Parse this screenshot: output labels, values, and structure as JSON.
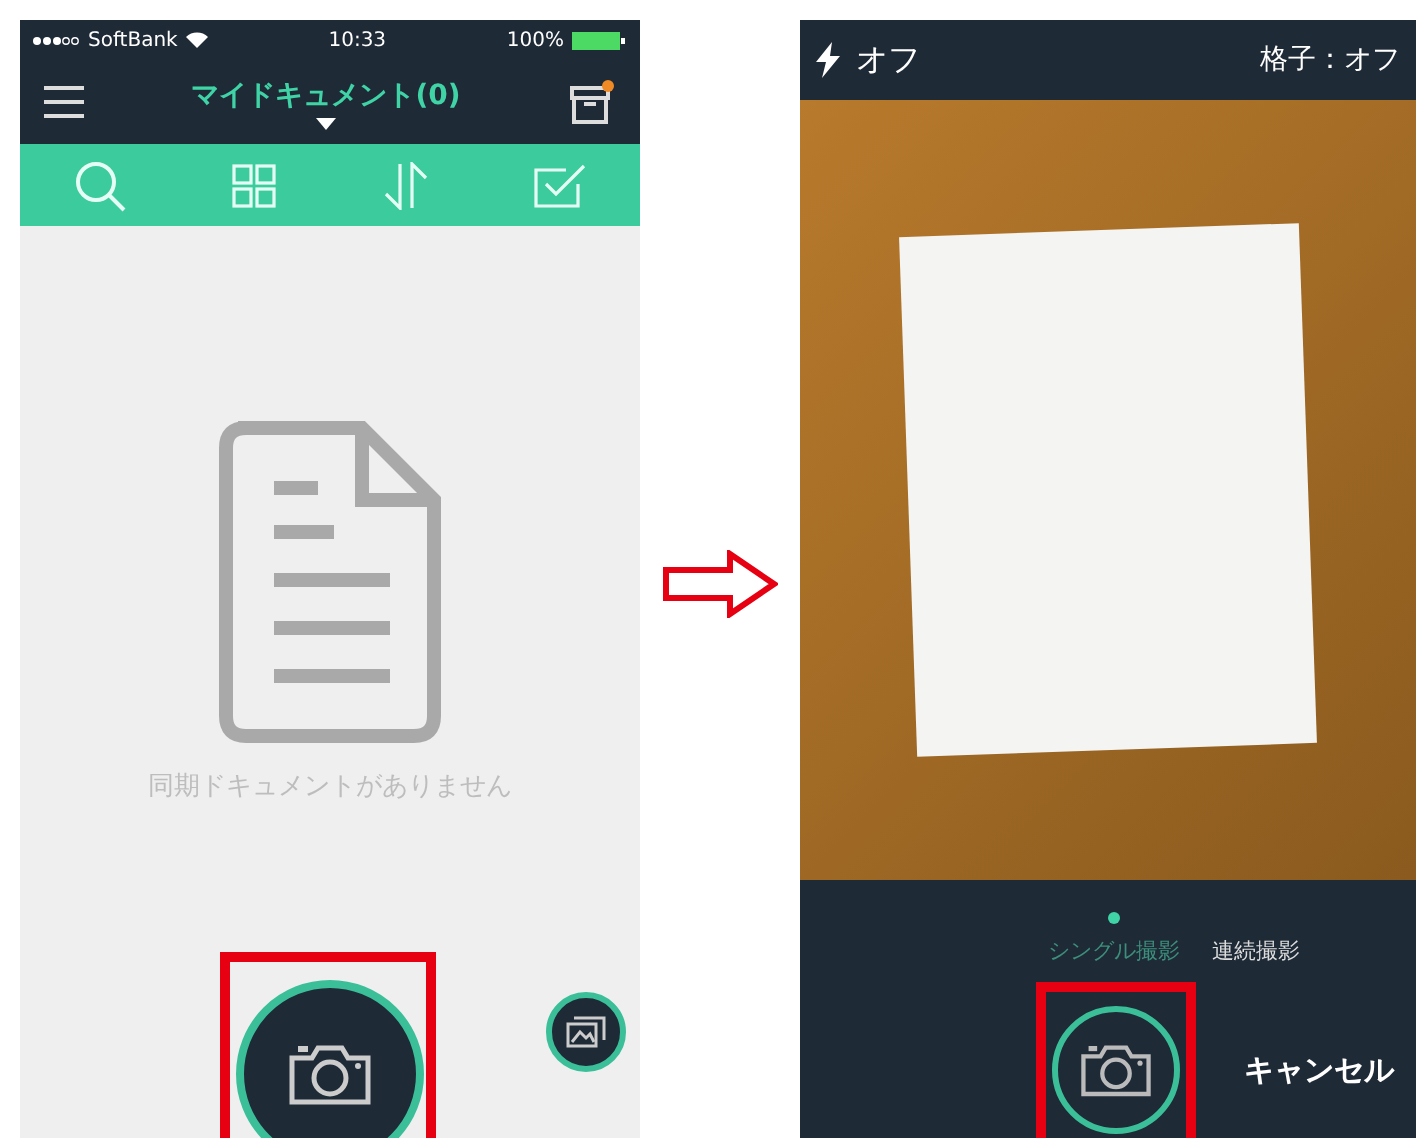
{
  "left_screen": {
    "status_bar": {
      "carrier": "SoftBank",
      "time": "10:33",
      "battery": "100%"
    },
    "header": {
      "title": "マイドキュメント(0)"
    },
    "empty_message": "同期ドキュメントがありません"
  },
  "right_screen": {
    "top_bar": {
      "flash": "オフ",
      "grid": "格子：オフ"
    },
    "modes": [
      {
        "label": "シングル撮影",
        "selected": true
      },
      {
        "label": "連続撮影",
        "selected": false
      }
    ],
    "cancel": "キャンセル"
  }
}
